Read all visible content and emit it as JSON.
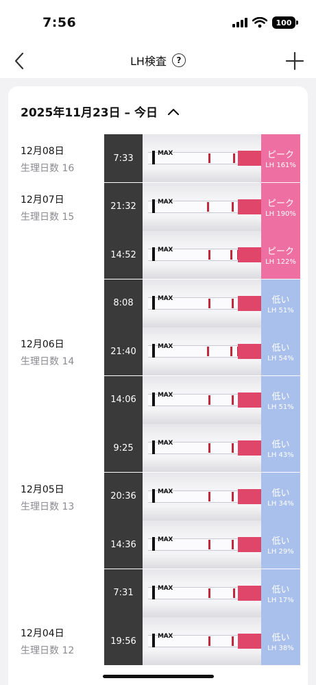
{
  "status": {
    "time": "7:56",
    "battery": "100"
  },
  "nav": {
    "title": "LH検査",
    "help": "?"
  },
  "range": {
    "label": "2025年11月23日 – 今日"
  },
  "days": [
    {
      "date": "12月08日",
      "cycle": "生理日数 16"
    },
    {
      "date": "12月07日",
      "cycle": "生理日数 15"
    },
    {
      "date": "12月06日",
      "cycle": "生理日数 14"
    },
    {
      "date": "12月05日",
      "cycle": "生理日数 13"
    },
    {
      "date": "12月04日",
      "cycle": "生理日数 12"
    }
  ],
  "tests": [
    {
      "time": "7:33",
      "level": "ピーク",
      "lh": "LH 161%",
      "kind": "peak"
    },
    {
      "time": "21:32",
      "level": "ピーク",
      "lh": "LH 190%",
      "kind": "peak"
    },
    {
      "time": "14:52",
      "level": "ピーク",
      "lh": "LH 122%",
      "kind": "peak"
    },
    {
      "time": "8:08",
      "level": "低い",
      "lh": "LH 51%",
      "kind": "low"
    },
    {
      "time": "21:40",
      "level": "低い",
      "lh": "LH 54%",
      "kind": "low"
    },
    {
      "time": "14:06",
      "level": "低い",
      "lh": "LH 51%",
      "kind": "low"
    },
    {
      "time": "9:25",
      "level": "低い",
      "lh": "LH 43%",
      "kind": "low"
    },
    {
      "time": "20:36",
      "level": "低い",
      "lh": "LH 34%",
      "kind": "low"
    },
    {
      "time": "14:36",
      "level": "低い",
      "lh": "LH 29%",
      "kind": "low"
    },
    {
      "time": "7:31",
      "level": "低い",
      "lh": "LH 17%",
      "kind": "low"
    },
    {
      "time": "19:56",
      "level": "低い",
      "lh": "LH 38%",
      "kind": "low"
    }
  ],
  "strip_label": "MAX",
  "colors": {
    "peak": "#ee6fa2",
    "low": "#a9c0ec"
  }
}
